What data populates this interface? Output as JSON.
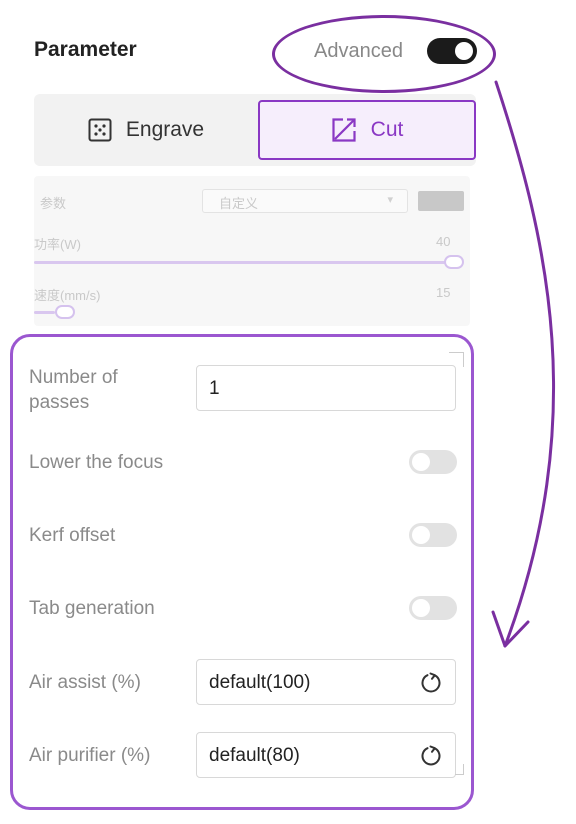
{
  "header": {
    "title": "Parameter",
    "advanced_label": "Advanced",
    "advanced_enabled": true
  },
  "mode_tabs": [
    {
      "label": "Engrave",
      "icon": "engrave-icon",
      "selected": false
    },
    {
      "label": "Cut",
      "icon": "cut-icon",
      "selected": true
    }
  ],
  "basic_panel": {
    "param_label": "参数",
    "preset_value": "自定义",
    "power_label": "功率(W)",
    "power_value": "40",
    "power_level": 1.0,
    "speed_label": "速度(mm/s)",
    "speed_value": "15",
    "speed_level": 0.05
  },
  "advanced": {
    "passes_label": "Number of passes",
    "passes_value": "1",
    "lower_focus_label": "Lower the focus",
    "lower_focus_on": false,
    "kerf_label": "Kerf offset",
    "kerf_on": false,
    "tab_gen_label": "Tab generation",
    "tab_gen_on": false,
    "air_assist_label": "Air assist (%)",
    "air_assist_value": "default(100)",
    "air_purifier_label": "Air purifier (%)",
    "air_purifier_value": "default(80)"
  },
  "colors": {
    "accent": "#8a38c4",
    "annotation": "#7a2fa0",
    "panel_border": "#9b57d0"
  }
}
